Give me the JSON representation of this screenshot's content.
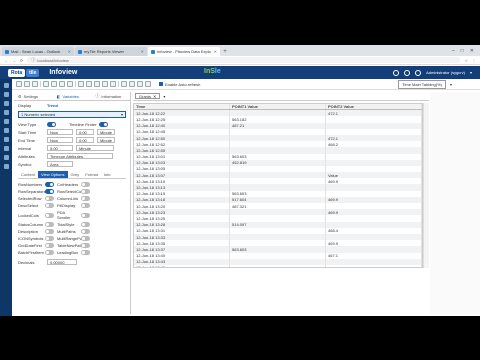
{
  "browser": {
    "tabs": [
      {
        "label": "Mail - Sean Lucas - Outlook"
      },
      {
        "label": "myTile Reports Viewer"
      },
      {
        "label": "Infoview - Pitoview Data Explo"
      }
    ],
    "address": "localhost/infoview"
  },
  "app": {
    "brand_left": "Rota",
    "brand_right": "tile",
    "title": "Infoview",
    "logo_left": "InS",
    "logo_right": "le",
    "user": "Administrator (sygcrv)"
  },
  "toolbar": {
    "checkbox_label": "Enable Auto-refresh",
    "selected_right": "Time Main Tabbing(%)"
  },
  "left_panel": {
    "tabs": [
      "Settings",
      "Variables",
      "Information"
    ],
    "display_label": "Display",
    "display_value": "Trend",
    "product_value": "1 Numeric selected",
    "view_type_label": "View Type",
    "view_type_value": "Timeline Finder",
    "start_time_label": "Start Time",
    "start_time_value": "Now",
    "start_offset": "0:00",
    "start_unit": "Minute",
    "end_time_label": "End Time",
    "end_time_value": "Now",
    "end_offset": "0:00",
    "end_unit": "Minute",
    "interval_label": "Interval",
    "interval_value": "5:00",
    "interval_unit": "Minute",
    "attributes_label": "Attributes",
    "attributes_value": "Timecue Attributes",
    "symbol_label": "Symbol",
    "symbol_value": "Area",
    "subtabs": [
      "Content",
      "View Options",
      "Grey",
      "Format",
      "Info"
    ],
    "options": [
      {
        "l": "RowNumbers",
        "on": true,
        "r": "ColHeaders",
        "ron": false
      },
      {
        "l": "RowSeparators",
        "on": true,
        "r": "RowSelectColumn",
        "ron": false
      },
      {
        "l": "SelectedRow",
        "on": false,
        "r": "ColumnLink",
        "ron": false
      },
      {
        "l": "DescSelect",
        "on": false,
        "r": "FillDisplay",
        "ron": false
      },
      {
        "l": "LockedCols",
        "on": false,
        "r": "PDA Scroller",
        "ron": false
      },
      {
        "l": "StatusColumn",
        "on": false,
        "r": "TidalStyle",
        "ron": false
      },
      {
        "l": "Description",
        "on": false,
        "r": "MultiPaths",
        "ron": false
      },
      {
        "l": "ICONSymbols",
        "on": false,
        "r": "MultiRangePaths",
        "ron": false
      },
      {
        "l": "GridDateFirst",
        "on": false,
        "r": "TableNewPath",
        "ron": false
      },
      {
        "l": "BatchFirstItem",
        "on": false,
        "r": "LeadingBox",
        "ron": false
      }
    ],
    "decimals_label": "Decimals",
    "decimals_value": "0.00000"
  },
  "main": {
    "tab_label": "Grants",
    "columns": [
      "Time",
      "POINT1 Value",
      "POINT2 Value"
    ],
    "rows": [
      [
        "12-Jun-18 12:22",
        "",
        "472.1"
      ],
      [
        "12-Jun-18 12:25",
        "563.152",
        ""
      ],
      [
        "12-Jun-18 12:40",
        "487.21",
        ""
      ],
      [
        "12-Jun-18 12:45",
        "",
        ""
      ],
      [
        "12-Jun-18 12:50",
        "",
        "472.1"
      ],
      [
        "12-Jun-18 12:52",
        "",
        "468.2"
      ],
      [
        "12-Jun-18 12:55",
        "",
        ""
      ],
      [
        "12-Jun-18 13:01",
        "563.603",
        ""
      ],
      [
        "12-Jun-18 13:03",
        "452.819",
        ""
      ],
      [
        "12-Jun-18 13:05",
        "",
        ""
      ],
      [
        "12-Jun-18 13:07",
        "",
        "Value"
      ],
      [
        "12-Jun-18 13:10",
        "",
        "469.9"
      ],
      [
        "12-Jun-18 13:13",
        "",
        ""
      ],
      [
        "12-Jun-18 13:15",
        "563.603",
        ""
      ],
      [
        "12-Jun-18 13:18",
        "517.604",
        "469.9"
      ],
      [
        "12-Jun-18 13:20",
        "487.321",
        ""
      ],
      [
        "12-Jun-18 13:23",
        "",
        "469.9"
      ],
      [
        "12-Jun-18 13:25",
        "",
        ""
      ],
      [
        "12-Jun-18 13:28",
        "514.097",
        ""
      ],
      [
        "12-Jun-18 13:31",
        "",
        "468.4"
      ],
      [
        "12-Jun-18 13:33",
        "",
        ""
      ],
      [
        "12-Jun-18 13:35",
        "",
        "469.9"
      ],
      [
        "12-Jun-18 13:37",
        "563.603",
        ""
      ],
      [
        "12-Jun-18 13:40",
        "",
        "467.1"
      ],
      [
        "12-Jun-18 13:43",
        "",
        ""
      ],
      [
        "12-Jun-18 13:45",
        "",
        ""
      ]
    ]
  }
}
